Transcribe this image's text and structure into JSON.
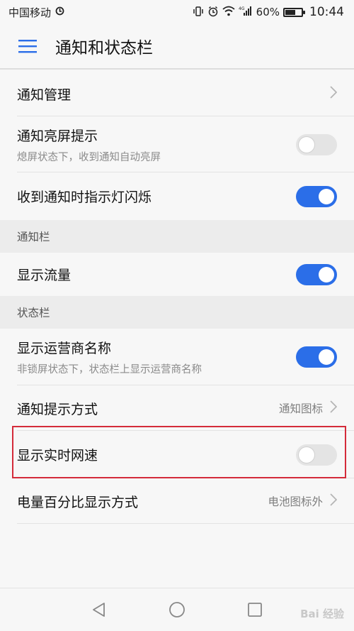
{
  "status_bar": {
    "carrier": "中国移动",
    "battery_percent": "60%",
    "battery_level": 0.6,
    "time": "10:44",
    "icons": [
      "hd-icon",
      "vibrate-icon",
      "alarm-icon",
      "wifi-icon",
      "signal-4g-icon",
      "battery-icon"
    ]
  },
  "app_bar": {
    "title": "通知和状态栏"
  },
  "rows": {
    "notify_manage": {
      "title": "通知管理"
    },
    "wake_screen": {
      "title": "通知亮屏提示",
      "subtitle": "熄屏状态下，收到通知自动亮屏",
      "enabled": false
    },
    "led_blink": {
      "title": "收到通知时指示灯闪烁",
      "enabled": true
    },
    "show_traffic": {
      "title": "显示流量",
      "enabled": true
    },
    "carrier_name": {
      "title": "显示运营商名称",
      "subtitle": "非锁屏状态下，状态栏上显示运营商名称",
      "enabled": true
    },
    "notify_style": {
      "title": "通知提示方式",
      "value": "通知图标"
    },
    "net_speed": {
      "title": "显示实时网速",
      "enabled": false
    },
    "battery_style": {
      "title": "电量百分比显示方式",
      "value": "电池图标外"
    }
  },
  "sections": {
    "notification_bar": "通知栏",
    "status_bar": "状态栏"
  },
  "watermark": "Bai 经验",
  "colors": {
    "accent": "#2b6ee8",
    "highlight": "#d42b3a"
  }
}
